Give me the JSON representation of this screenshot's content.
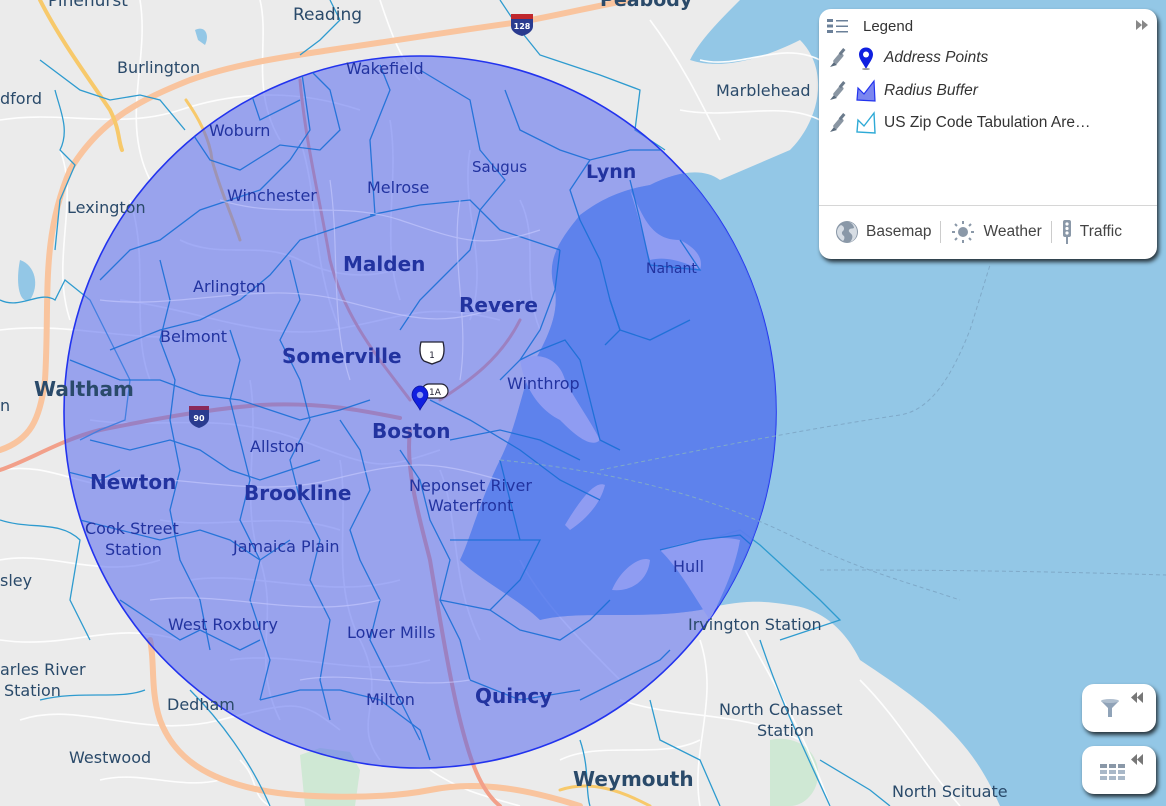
{
  "map": {
    "colors": {
      "land": "#ebebeb",
      "water": "#93c7e6",
      "road": "#ffffff",
      "highway": "#f9c49e",
      "highway_yellow": "#f7c96b",
      "buffer_fill": "#5567ee",
      "buffer_stroke": "#2233ee",
      "zip_stroke": "#2e9bcf",
      "zip_inner_stroke": "#1a6fd6",
      "pin": "#1020e0",
      "park": "#cfe8d4"
    },
    "shields": [
      {
        "name": "interstate-128-shield",
        "text": "128"
      },
      {
        "name": "interstate-90-shield",
        "text": "90"
      },
      {
        "name": "us-route-1-shield",
        "text": "1"
      },
      {
        "name": "route-1a-shield",
        "text": "1A"
      }
    ],
    "place_labels": [
      {
        "name": "Pinehurst",
        "text": "Pinehurst"
      },
      {
        "name": "Reading",
        "text": "Reading"
      },
      {
        "name": "Peabody",
        "text": "Peabody"
      },
      {
        "name": "Burlington",
        "text": "Burlington"
      },
      {
        "name": "Bedford",
        "text": "dford"
      },
      {
        "name": "Wakefield",
        "text": "Wakefield"
      },
      {
        "name": "Marblehead",
        "text": "Marblehead"
      },
      {
        "name": "Woburn",
        "text": "Woburn"
      },
      {
        "name": "Saugus",
        "text": "Saugus"
      },
      {
        "name": "Lynn",
        "text": "Lynn"
      },
      {
        "name": "Melrose",
        "text": "Melrose"
      },
      {
        "name": "Winchester",
        "text": "Winchester"
      },
      {
        "name": "Lexington",
        "text": "Lexington"
      },
      {
        "name": "Malden",
        "text": "Malden"
      },
      {
        "name": "Nahant",
        "text": "Nahant"
      },
      {
        "name": "Arlington",
        "text": "Arlington"
      },
      {
        "name": "Revere",
        "text": "Revere"
      },
      {
        "name": "Belmont",
        "text": "Belmont"
      },
      {
        "name": "Somerville",
        "text": "Somerville"
      },
      {
        "name": "Winthrop",
        "text": "Winthrop"
      },
      {
        "name": "Waltham",
        "text": "Waltham"
      },
      {
        "name": "Weston",
        "text": "n"
      },
      {
        "name": "Allston",
        "text": "Allston"
      },
      {
        "name": "Boston",
        "text": "Boston"
      },
      {
        "name": "Newton",
        "text": "Newton"
      },
      {
        "name": "Brookline",
        "text": "Brookline"
      },
      {
        "name": "Neponset River",
        "text": "Neponset River"
      },
      {
        "name": "Waterfront",
        "text": "Waterfront"
      },
      {
        "name": "Cook Street",
        "text": "Cook Street"
      },
      {
        "name": "Station",
        "text": "Station"
      },
      {
        "name": "Jamaica Plain",
        "text": "Jamaica Plain"
      },
      {
        "name": "Hull",
        "text": "Hull"
      },
      {
        "name": "Wellesley",
        "text": "sley"
      },
      {
        "name": "Irvington Station",
        "text": "Irvington Station"
      },
      {
        "name": "West Roxbury",
        "text": "West Roxbury"
      },
      {
        "name": "Lower Mills",
        "text": "Lower Mills"
      },
      {
        "name": "Charles River",
        "text": "arles River"
      },
      {
        "name": "Charles River Station",
        "text": "Station"
      },
      {
        "name": "Quincy",
        "text": "Quincy"
      },
      {
        "name": "Milton",
        "text": "Milton"
      },
      {
        "name": "Dedham",
        "text": "Dedham"
      },
      {
        "name": "North Cohasset",
        "text": "North Cohasset"
      },
      {
        "name": "North Cohasset Station",
        "text": "Station"
      },
      {
        "name": "Westwood",
        "text": "Westwood"
      },
      {
        "name": "Weymouth",
        "text": "Weymouth"
      },
      {
        "name": "North Scituate",
        "text": "North Scituate"
      }
    ],
    "address_point": {
      "label": "Address point marker"
    }
  },
  "legend": {
    "title": "Legend",
    "collapse_icon": "double-chevron-right-icon",
    "layers": [
      {
        "name": "Address Points",
        "italic": true,
        "symbol": "map-pin-icon",
        "color": "#1020e0"
      },
      {
        "name": "Radius Buffer",
        "italic": true,
        "symbol": "polygon-fill-icon",
        "color": "#5567ee"
      },
      {
        "name": "US Zip Code Tabulation Are…",
        "italic": false,
        "symbol": "polygon-outline-icon",
        "color": "#2e9bcf"
      }
    ],
    "footer": [
      {
        "label": "Basemap",
        "icon": "globe-icon"
      },
      {
        "label": "Weather",
        "icon": "sun-icon"
      },
      {
        "label": "Traffic",
        "icon": "traffic-light-icon"
      }
    ]
  },
  "tools": {
    "filter": {
      "icon": "funnel-icon",
      "expand_icon": "double-chevron-left-icon"
    },
    "table": {
      "icon": "grid-table-icon",
      "expand_icon": "double-chevron-left-icon"
    }
  }
}
